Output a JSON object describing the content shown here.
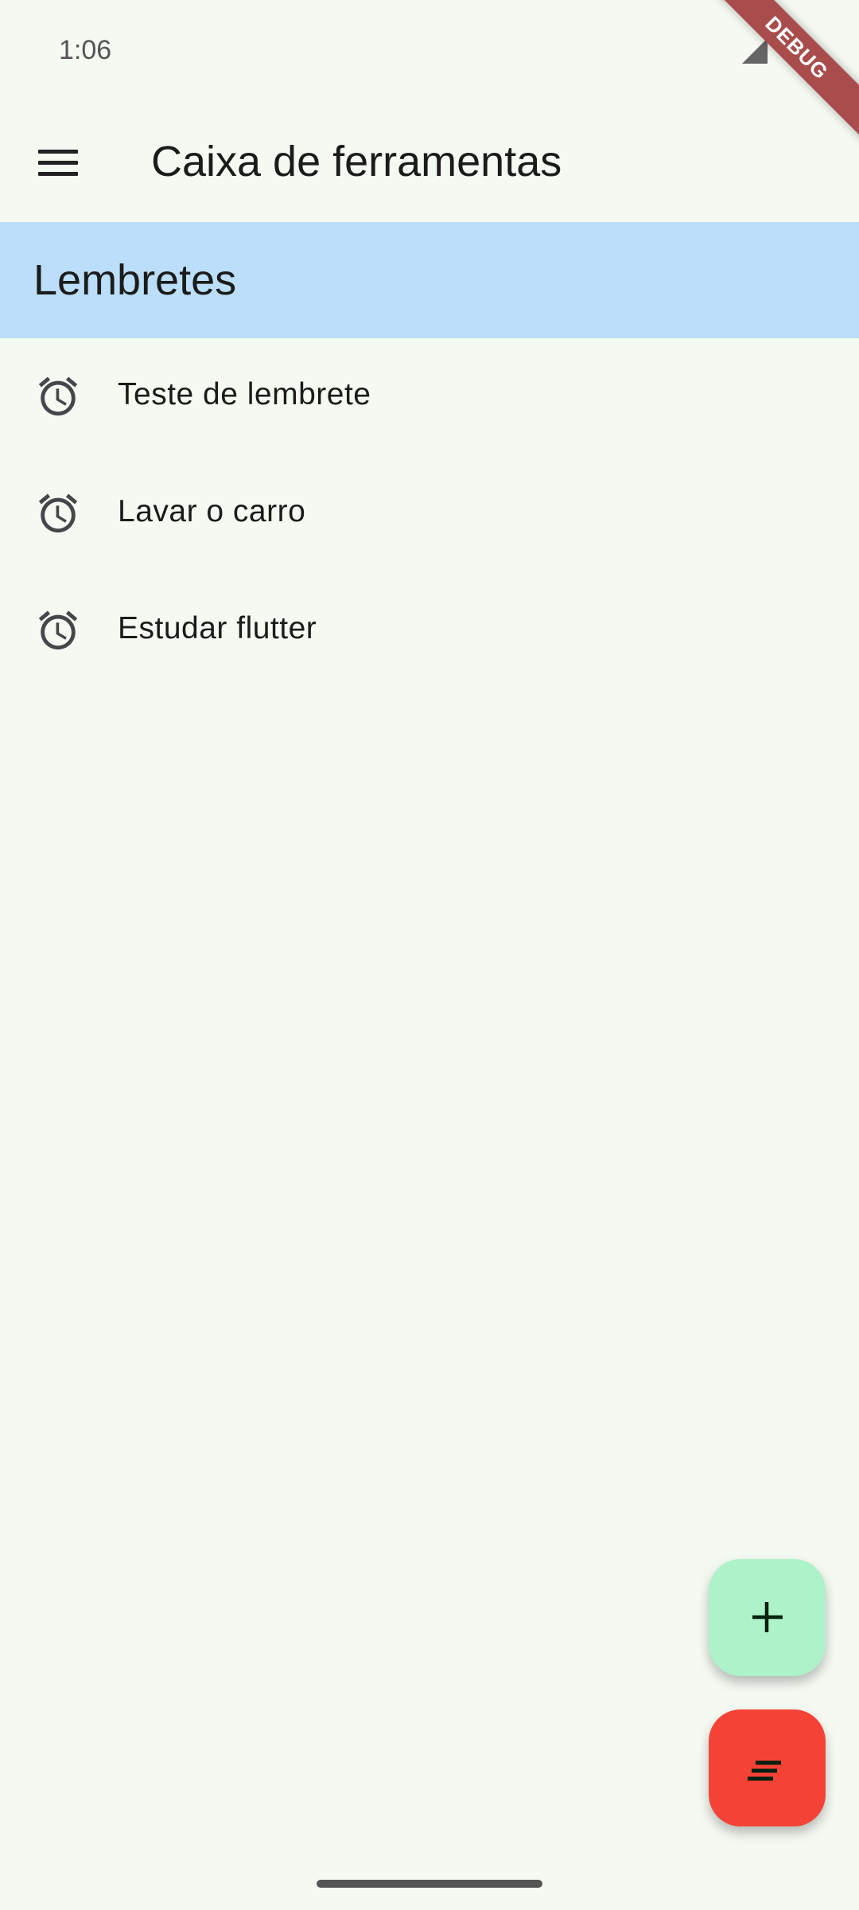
{
  "status_bar": {
    "time": "1:06"
  },
  "debug_banner": "DEBUG",
  "app_bar": {
    "title": "Caixa de ferramentas"
  },
  "section": {
    "title": "Lembretes"
  },
  "reminders": [
    {
      "label": "Teste de lembrete",
      "icon": "alarm-icon"
    },
    {
      "label": "Lavar o carro",
      "icon": "alarm-icon"
    },
    {
      "label": "Estudar flutter",
      "icon": "alarm-icon"
    }
  ],
  "fabs": {
    "add": {
      "icon": "plus-icon",
      "color": "#adf2c8"
    },
    "sort": {
      "icon": "sort-icon",
      "color": "#f44336"
    }
  }
}
